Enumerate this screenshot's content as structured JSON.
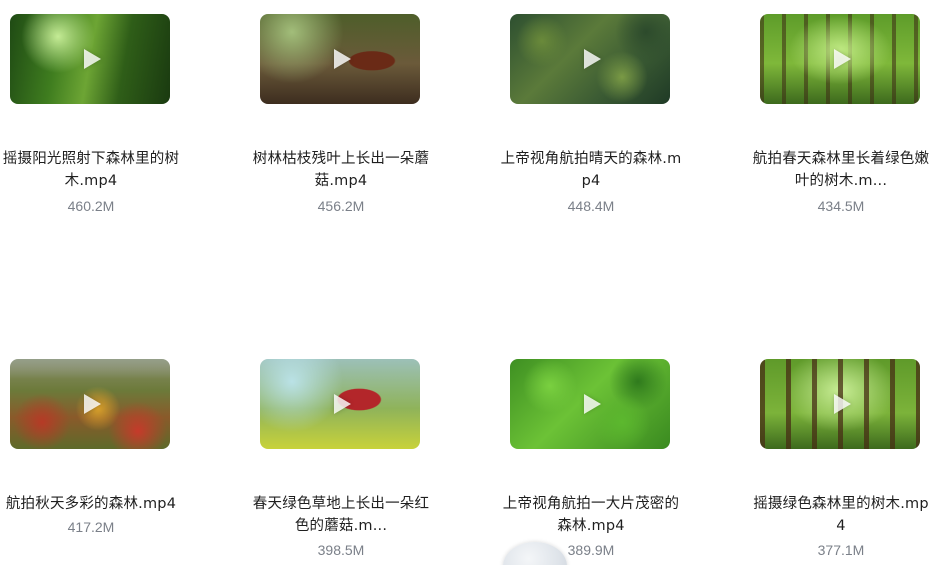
{
  "videos": [
    {
      "name": "摇摄阳光照射下森林里的树木.mp4",
      "size": "460.2M",
      "thumb_icon": "play-icon"
    },
    {
      "name": "树林枯枝残叶上长出一朵蘑菇.mp4",
      "size": "456.2M",
      "thumb_icon": "play-icon"
    },
    {
      "name": "上帝视角航拍晴天的森林.mp4",
      "size": "448.4M",
      "thumb_icon": "play-icon"
    },
    {
      "name": "航拍春天森林里长着绿色嫩叶的树木.m...",
      "size": "434.5M",
      "thumb_icon": "play-icon"
    },
    {
      "name": "航拍秋天多彩的森林.mp4",
      "size": "417.2M",
      "thumb_icon": "play-icon"
    },
    {
      "name": "春天绿色草地上长出一朵红色的蘑菇.m...",
      "size": "398.5M",
      "thumb_icon": "play-icon"
    },
    {
      "name": "上帝视角航拍一大片茂密的森林.mp4",
      "size": "389.9M",
      "thumb_icon": "play-icon"
    },
    {
      "name": "摇摄绿色森林里的树木.mp4",
      "size": "377.1M",
      "thumb_icon": "play-icon"
    }
  ],
  "colors": {
    "filename": "#1f1f1f",
    "filesize": "#7b8089",
    "background": "#ffffff"
  }
}
